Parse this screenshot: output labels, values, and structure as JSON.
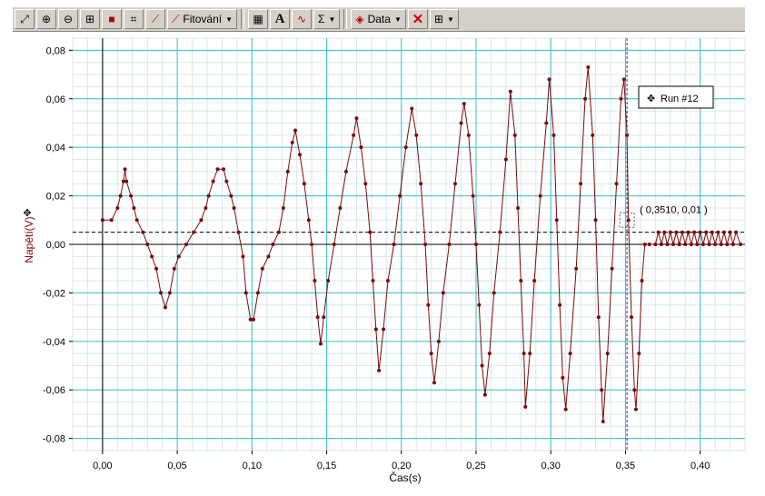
{
  "toolbar": {
    "fit_label": "Fitování",
    "data_label": "Data",
    "text_tool_label": "A",
    "sum_label": "Σ"
  },
  "colors": {
    "series": "#7a0a0a",
    "grid_major": "#3bbfc9",
    "grid_minor": "#d8e8e8",
    "cursor": "#1a3a8f"
  },
  "chart_data": {
    "type": "line",
    "xlabel": "Čas(s)",
    "ylabel": "Napětí(V)",
    "xlim": [
      -0.02,
      0.43
    ],
    "ylim": [
      -0.085,
      0.085
    ],
    "x_ticks": [
      "0,00",
      "0,05",
      "0,10",
      "0,15",
      "0,20",
      "0,25",
      "0,30",
      "0,35",
      "0,40"
    ],
    "y_ticks": [
      "0,08",
      "0,06",
      "0,04",
      "0,02",
      "0,00",
      "-0,02",
      "-0,04",
      "-0,06",
      "-0,08"
    ],
    "grid": true,
    "legend_position": "top-right",
    "series": [
      {
        "name": "Run #12",
        "points": [
          [
            0.0,
            0.01
          ],
          [
            0.006,
            0.01
          ],
          [
            0.01,
            0.015
          ],
          [
            0.012,
            0.02
          ],
          [
            0.014,
            0.026
          ],
          [
            0.015,
            0.031
          ],
          [
            0.016,
            0.026
          ],
          [
            0.019,
            0.02
          ],
          [
            0.021,
            0.015
          ],
          [
            0.023,
            0.01
          ],
          [
            0.027,
            0.005
          ],
          [
            0.03,
            0.0
          ],
          [
            0.033,
            -0.005
          ],
          [
            0.036,
            -0.01
          ],
          [
            0.039,
            -0.02
          ],
          [
            0.042,
            -0.026
          ],
          [
            0.045,
            -0.02
          ],
          [
            0.048,
            -0.01
          ],
          [
            0.051,
            -0.005
          ],
          [
            0.056,
            0.0
          ],
          [
            0.061,
            0.005
          ],
          [
            0.066,
            0.01
          ],
          [
            0.069,
            0.015
          ],
          [
            0.071,
            0.02
          ],
          [
            0.074,
            0.026
          ],
          [
            0.077,
            0.031
          ],
          [
            0.081,
            0.031
          ],
          [
            0.083,
            0.026
          ],
          [
            0.086,
            0.02
          ],
          [
            0.088,
            0.015
          ],
          [
            0.091,
            0.005
          ],
          [
            0.094,
            -0.005
          ],
          [
            0.096,
            -0.02
          ],
          [
            0.099,
            -0.031
          ],
          [
            0.101,
            -0.031
          ],
          [
            0.104,
            -0.02
          ],
          [
            0.107,
            -0.01
          ],
          [
            0.111,
            -0.005
          ],
          [
            0.114,
            0.0
          ],
          [
            0.118,
            0.005
          ],
          [
            0.121,
            0.015
          ],
          [
            0.124,
            0.03
          ],
          [
            0.127,
            0.042
          ],
          [
            0.129,
            0.047
          ],
          [
            0.132,
            0.037
          ],
          [
            0.135,
            0.025
          ],
          [
            0.138,
            0.01
          ],
          [
            0.14,
            0.0
          ],
          [
            0.142,
            -0.015
          ],
          [
            0.144,
            -0.03
          ],
          [
            0.146,
            -0.041
          ],
          [
            0.148,
            -0.03
          ],
          [
            0.151,
            -0.015
          ],
          [
            0.155,
            0.0
          ],
          [
            0.159,
            0.015
          ],
          [
            0.163,
            0.03
          ],
          [
            0.168,
            0.045
          ],
          [
            0.17,
            0.052
          ],
          [
            0.173,
            0.04
          ],
          [
            0.176,
            0.025
          ],
          [
            0.179,
            0.005
          ],
          [
            0.181,
            -0.015
          ],
          [
            0.183,
            -0.035
          ],
          [
            0.185,
            -0.052
          ],
          [
            0.188,
            -0.035
          ],
          [
            0.191,
            -0.015
          ],
          [
            0.195,
            0.0
          ],
          [
            0.199,
            0.02
          ],
          [
            0.203,
            0.04
          ],
          [
            0.207,
            0.056
          ],
          [
            0.21,
            0.045
          ],
          [
            0.213,
            0.025
          ],
          [
            0.216,
            0.0
          ],
          [
            0.218,
            -0.025
          ],
          [
            0.22,
            -0.045
          ],
          [
            0.222,
            -0.057
          ],
          [
            0.225,
            -0.04
          ],
          [
            0.228,
            -0.02
          ],
          [
            0.232,
            0.0
          ],
          [
            0.236,
            0.025
          ],
          [
            0.24,
            0.05
          ],
          [
            0.242,
            0.058
          ],
          [
            0.245,
            0.045
          ],
          [
            0.248,
            0.02
          ],
          [
            0.25,
            0.0
          ],
          [
            0.252,
            -0.025
          ],
          [
            0.254,
            -0.05
          ],
          [
            0.256,
            -0.062
          ],
          [
            0.259,
            -0.045
          ],
          [
            0.262,
            -0.02
          ],
          [
            0.266,
            0.005
          ],
          [
            0.27,
            0.035
          ],
          [
            0.273,
            0.063
          ],
          [
            0.276,
            0.045
          ],
          [
            0.278,
            0.015
          ],
          [
            0.28,
            -0.015
          ],
          [
            0.282,
            -0.045
          ],
          [
            0.283,
            -0.067
          ],
          [
            0.286,
            -0.045
          ],
          [
            0.289,
            -0.015
          ],
          [
            0.293,
            0.02
          ],
          [
            0.297,
            0.05
          ],
          [
            0.299,
            0.068
          ],
          [
            0.302,
            0.045
          ],
          [
            0.304,
            0.01
          ],
          [
            0.306,
            -0.025
          ],
          [
            0.308,
            -0.055
          ],
          [
            0.31,
            -0.068
          ],
          [
            0.313,
            -0.045
          ],
          [
            0.317,
            -0.01
          ],
          [
            0.32,
            0.025
          ],
          [
            0.323,
            0.06
          ],
          [
            0.325,
            0.073
          ],
          [
            0.328,
            0.045
          ],
          [
            0.33,
            0.01
          ],
          [
            0.332,
            -0.03
          ],
          [
            0.334,
            -0.06
          ],
          [
            0.335,
            -0.073
          ],
          [
            0.338,
            -0.045
          ],
          [
            0.341,
            -0.01
          ],
          [
            0.344,
            0.025
          ],
          [
            0.347,
            0.06
          ],
          [
            0.349,
            0.068
          ],
          [
            0.351,
            0.045
          ],
          [
            0.352,
            0.01
          ],
          [
            0.354,
            -0.03
          ],
          [
            0.356,
            -0.06
          ],
          [
            0.357,
            -0.068
          ],
          [
            0.359,
            -0.045
          ],
          [
            0.361,
            -0.015
          ],
          [
            0.363,
            0.0
          ],
          [
            0.366,
            0.0
          ],
          [
            0.37,
            0.0
          ],
          [
            0.372,
            0.005
          ],
          [
            0.374,
            0.0
          ],
          [
            0.376,
            0.005
          ],
          [
            0.378,
            0.0
          ],
          [
            0.38,
            0.005
          ],
          [
            0.382,
            0.0
          ],
          [
            0.384,
            0.005
          ],
          [
            0.386,
            0.0
          ],
          [
            0.388,
            0.005
          ],
          [
            0.39,
            0.0
          ],
          [
            0.392,
            0.005
          ],
          [
            0.394,
            0.0
          ],
          [
            0.396,
            0.005
          ],
          [
            0.398,
            0.0
          ],
          [
            0.4,
            0.005
          ],
          [
            0.402,
            0.0
          ],
          [
            0.404,
            0.005
          ],
          [
            0.406,
            0.0
          ],
          [
            0.408,
            0.005
          ],
          [
            0.41,
            0.0
          ],
          [
            0.412,
            0.005
          ],
          [
            0.414,
            0.0
          ],
          [
            0.416,
            0.005
          ],
          [
            0.418,
            0.0
          ],
          [
            0.42,
            0.005
          ],
          [
            0.422,
            0.0
          ],
          [
            0.424,
            0.005
          ],
          [
            0.427,
            0.0
          ]
        ]
      }
    ],
    "reference_line_y": 0.005,
    "cursor": {
      "x": 0.351,
      "y": 0.01,
      "label": "( 0,3510, 0,01 )"
    }
  }
}
